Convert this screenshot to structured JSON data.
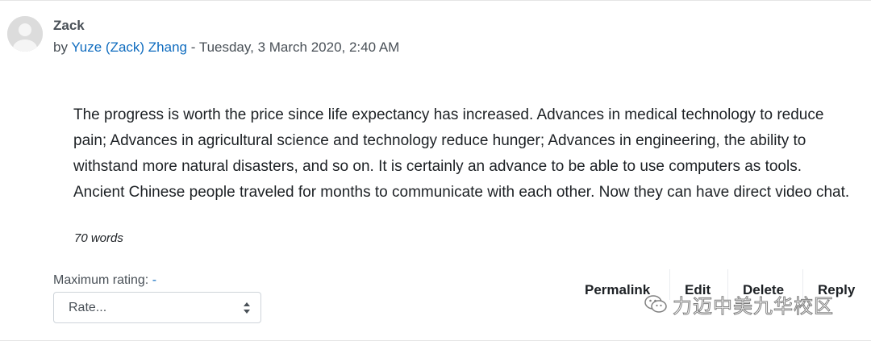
{
  "post": {
    "subject": "Zack",
    "byline": {
      "prefix": "by ",
      "author": "Yuze (Zack) Zhang",
      "separator": " - ",
      "date": "Tuesday, 3 March 2020, 2:40 AM"
    },
    "content": "The progress is worth the price since life expectancy has increased. Advances in medical technology to reduce pain; Advances in agricultural science and technology reduce hunger; Advances in engineering, the ability to withstand more natural disasters, and so on. It is certainly an advance to be able to use computers as tools. Ancient Chinese people traveled for months to communicate with each other. Now they can have direct video chat.",
    "word_count": "70 words"
  },
  "rating": {
    "label": "Maximum rating: ",
    "max_value": "-",
    "select_value": "Rate..."
  },
  "actions": {
    "permalink": "Permalink",
    "edit": "Edit",
    "delete": "Delete",
    "reply": "Reply"
  },
  "watermark": {
    "text": "力迈中美九华校区",
    "icon": "wechat-icon"
  },
  "colors": {
    "link": "#0f6cbf",
    "text": "#1d2125",
    "muted": "#495057"
  }
}
